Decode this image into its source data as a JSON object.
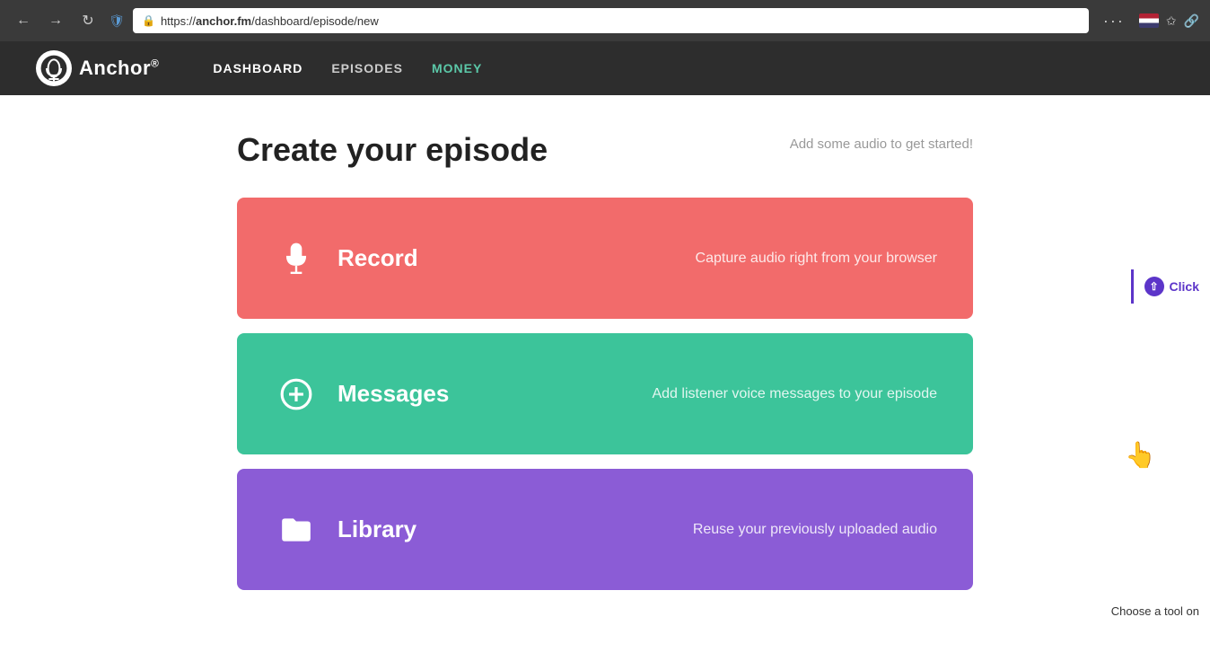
{
  "browser": {
    "url_prefix": "https://",
    "url_domain": "anchor.fm",
    "url_path": "/dashboard/episode/new",
    "menu_dots": "···"
  },
  "nav": {
    "logo_text": "Anchor",
    "logo_reg": "®",
    "links": [
      {
        "label": "DASHBOARD",
        "active": true
      },
      {
        "label": "EPISODES",
        "active": false
      },
      {
        "label": "MONEY",
        "active": false,
        "accent": true
      }
    ]
  },
  "page": {
    "title": "Create your episode",
    "subtitle": "Add some audio to get started!",
    "cards": [
      {
        "id": "record",
        "label": "Record",
        "description": "Capture audio right from your browser",
        "color": "#f26b6b"
      },
      {
        "id": "messages",
        "label": "Messages",
        "description": "Add listener voice messages to your episode",
        "color": "#3cc49a"
      },
      {
        "id": "library",
        "label": "Library",
        "description": "Reuse your previously uploaded audio",
        "color": "#8b5cd6"
      }
    ]
  },
  "annotation": {
    "click_label": "Click",
    "bottom_label": "Choose a tool on"
  }
}
